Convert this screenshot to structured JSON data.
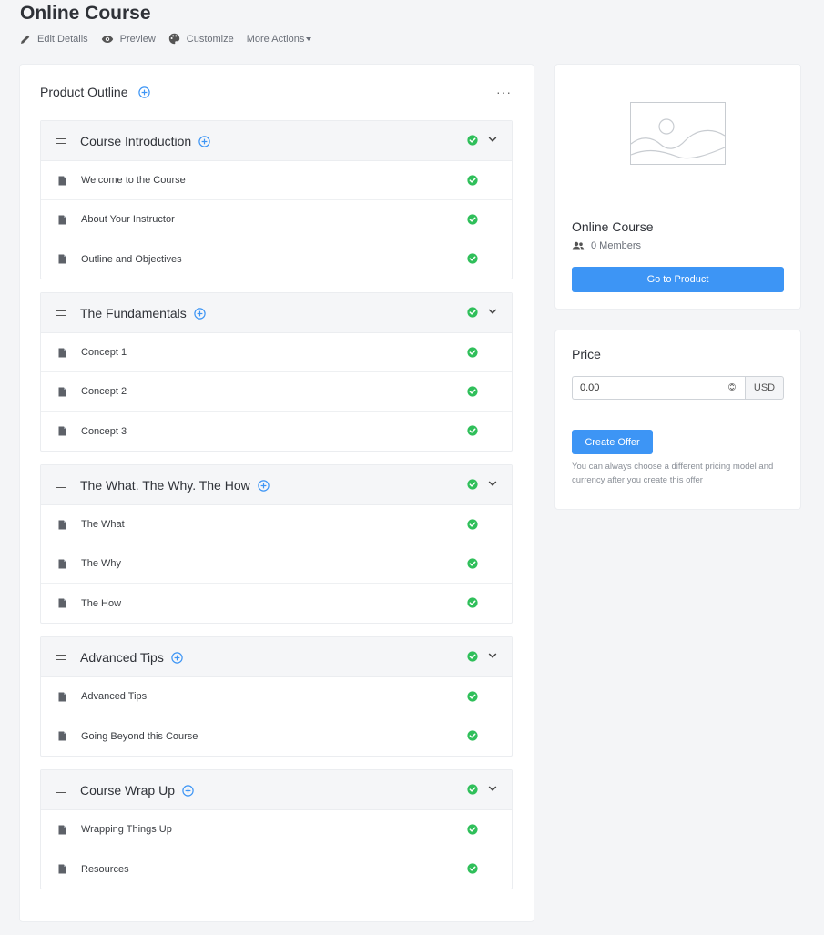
{
  "page": {
    "title": "Online Course",
    "actions": {
      "edit": "Edit Details",
      "preview": "Preview",
      "customize": "Customize",
      "more": "More Actions"
    }
  },
  "outline": {
    "title": "Product Outline",
    "more": "···",
    "sections": [
      {
        "title": "Course Introduction",
        "lessons": [
          "Welcome to the Course",
          "About Your Instructor",
          "Outline and Objectives"
        ]
      },
      {
        "title": "The Fundamentals",
        "lessons": [
          "Concept 1",
          "Concept 2",
          "Concept 3"
        ]
      },
      {
        "title": "The What. The Why. The How",
        "lessons": [
          "The What",
          "The Why",
          "The How"
        ]
      },
      {
        "title": "Advanced Tips",
        "lessons": [
          "Advanced Tips",
          "Going Beyond this Course"
        ]
      },
      {
        "title": "Course Wrap Up",
        "lessons": [
          "Wrapping Things Up",
          "Resources"
        ]
      }
    ]
  },
  "product": {
    "name": "Online Course",
    "members": "0 Members",
    "button": "Go to Product"
  },
  "price": {
    "title": "Price",
    "value": "0.00",
    "currency": "USD",
    "button": "Create Offer",
    "hint": "You can always choose a different pricing model and currency after you create this offer"
  },
  "colors": {
    "accent": "#3d95f5",
    "success": "#2fbf5a"
  }
}
